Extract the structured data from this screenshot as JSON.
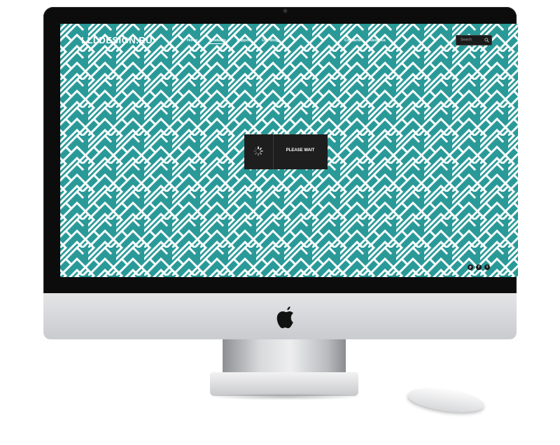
{
  "site": {
    "logo": "LLLDESIGN.RU",
    "pattern_color": "#2a9a99",
    "pattern_stripe": "#ffffff"
  },
  "nav": {
    "items": [
      {
        "label": "Home",
        "active": false
      },
      {
        "label": "Products",
        "active": true
      },
      {
        "label": "Support",
        "active": false
      },
      {
        "label": "Our Blog",
        "active": false
      },
      {
        "label": "Contacts",
        "active": false
      },
      {
        "label": "About us",
        "active": false
      }
    ]
  },
  "search": {
    "placeholder": "Search",
    "icon": "search-icon"
  },
  "loading": {
    "label": "PLEASE WAIT",
    "icon": "spinner-icon"
  },
  "social": [
    {
      "name": "pinterest-icon",
      "glyph": "p"
    },
    {
      "name": "facebook-icon",
      "glyph": "f"
    },
    {
      "name": "twitter-icon",
      "glyph": "t"
    }
  ]
}
